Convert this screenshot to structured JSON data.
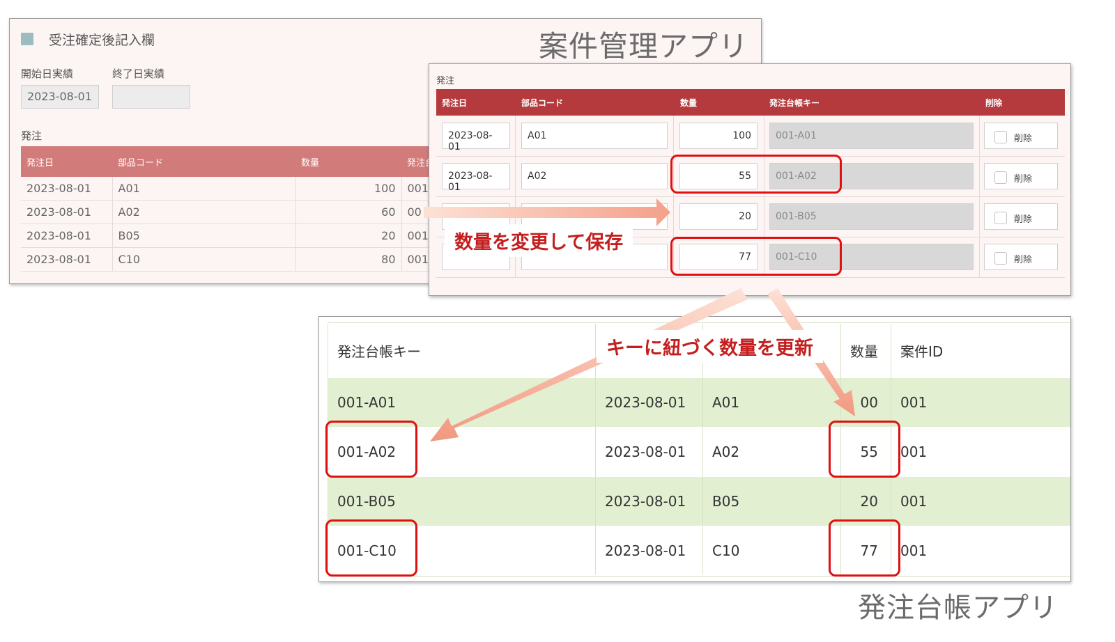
{
  "anken_app": {
    "app_label": "案件管理アプリ",
    "section_title": "受注確定後記入欄",
    "start_label": "開始日実績",
    "start_value": "2023-08-01",
    "end_label": "終了日実績",
    "end_value": "",
    "order_title": "発注",
    "headers": [
      "発注日",
      "部品コード",
      "数量",
      "発注台"
    ],
    "rows": [
      {
        "date": "2023-08-01",
        "code": "A01",
        "qty": "100",
        "key": "001"
      },
      {
        "date": "2023-08-01",
        "code": "A02",
        "qty": "60",
        "key": "00"
      },
      {
        "date": "2023-08-01",
        "code": "B05",
        "qty": "20",
        "key": "001"
      },
      {
        "date": "2023-08-01",
        "code": "C10",
        "qty": "80",
        "key": "001"
      }
    ]
  },
  "order_form": {
    "title": "発注",
    "headers": [
      "発注日",
      "部品コード",
      "数量",
      "発注台帳キー",
      "削除"
    ],
    "delete_label": "削除",
    "rows": [
      {
        "date": "2023-08-01",
        "code": "A01",
        "qty": "100",
        "key": "001-A01"
      },
      {
        "date": "2023-08-01",
        "code": "A02",
        "qty": "55",
        "key": "001-A02"
      },
      {
        "date": "",
        "code": "",
        "qty": "20",
        "key": "001-B05"
      },
      {
        "date": "",
        "code": "",
        "qty": "77",
        "key": "001-C10"
      }
    ]
  },
  "ledger_app": {
    "app_label": "発注台帳アプリ",
    "headers": [
      "発注台帳キー",
      "",
      "",
      "数量",
      "案件ID"
    ],
    "rows": [
      {
        "key": "001-A01",
        "date": "2023-08-01",
        "code": "A01",
        "qty": "00",
        "case_id": "001"
      },
      {
        "key": "001-A02",
        "date": "2023-08-01",
        "code": "A02",
        "qty": "55",
        "case_id": "001"
      },
      {
        "key": "001-B05",
        "date": "2023-08-01",
        "code": "B05",
        "qty": "20",
        "case_id": "001"
      },
      {
        "key": "001-C10",
        "date": "2023-08-01",
        "code": "C10",
        "qty": "77",
        "case_id": "001"
      }
    ]
  },
  "callouts": {
    "change_qty": "数量を変更して保存",
    "update_by_key": "キーに紐づく数量を更新"
  },
  "colors": {
    "header_red": "#b53a3d",
    "header_pink": "#d27b7b",
    "highlight": "#e01010",
    "callout_text": "#c41e1e",
    "row_green": "#e2efd1"
  }
}
